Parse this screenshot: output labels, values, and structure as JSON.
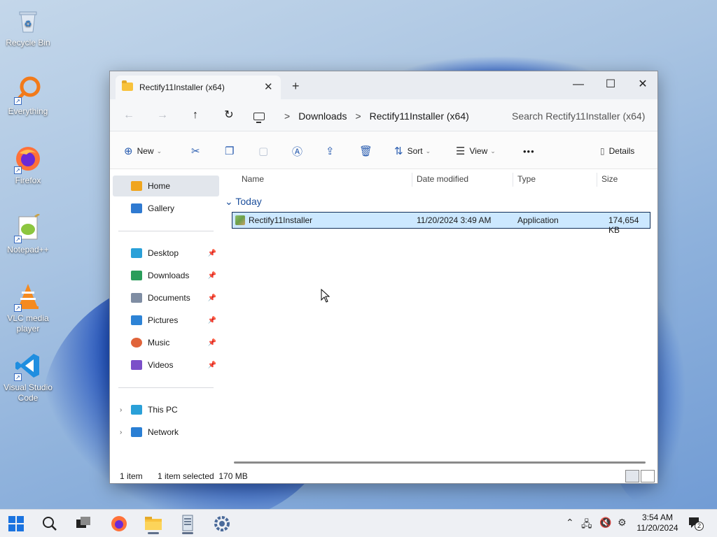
{
  "desktop": {
    "icons": [
      {
        "label": "Recycle Bin",
        "icon": "recycle-bin-icon"
      },
      {
        "label": "Everything",
        "icon": "everything-search-icon"
      },
      {
        "label": "Firefox",
        "icon": "firefox-icon"
      },
      {
        "label": "Notepad++",
        "icon": "notepad-plus-plus-icon"
      },
      {
        "label": "VLC media player",
        "icon": "vlc-icon"
      },
      {
        "label": "Visual Studio Code",
        "icon": "vscode-icon"
      }
    ]
  },
  "window": {
    "tab_title": "Rectify11Installer (x64)",
    "tab_close": "✕",
    "new_tab": "+",
    "controls": {
      "minimize": "—",
      "maximize": "☐",
      "close": "✕"
    },
    "nav": {
      "back": "←",
      "forward": "→",
      "up": "↑",
      "refresh": "↻"
    },
    "breadcrumb": [
      "Downloads",
      "Rectify11Installer (x64)"
    ],
    "breadcrumb_sep": ">",
    "search_placeholder": "Search Rectify11Installer (x64)",
    "toolbar": {
      "new_label": "New",
      "sort_label": "Sort",
      "view_label": "View",
      "more_label": "•••",
      "details_label": "Details"
    },
    "sidebar": {
      "top": [
        {
          "label": "Home",
          "icon": "home-icon",
          "color": "#f0a51e"
        },
        {
          "label": "Gallery",
          "icon": "gallery-icon",
          "color": "#2f7ad1"
        }
      ],
      "quick": [
        {
          "label": "Desktop",
          "icon": "desktop-icon",
          "color": "#2aa0d8"
        },
        {
          "label": "Downloads",
          "icon": "downloads-icon",
          "color": "#2a9d5a"
        },
        {
          "label": "Documents",
          "icon": "documents-icon",
          "color": "#7f8da3"
        },
        {
          "label": "Pictures",
          "icon": "pictures-icon",
          "color": "#2d83d6"
        },
        {
          "label": "Music",
          "icon": "music-icon",
          "color": "#e0643a"
        },
        {
          "label": "Videos",
          "icon": "videos-icon",
          "color": "#7b4fc9"
        }
      ],
      "bottom": [
        {
          "label": "This PC",
          "icon": "this-pc-icon",
          "color": "#2aa0d8"
        },
        {
          "label": "Network",
          "icon": "network-icon",
          "color": "#2a7fd4"
        }
      ],
      "pin_glyph": "📌"
    },
    "columns": [
      "Name",
      "Date modified",
      "Type",
      "Size"
    ],
    "group_label": "Today",
    "files": [
      {
        "name": "Rectify11Installer",
        "date": "11/20/2024 3:49 AM",
        "type": "Application",
        "size": "174,654 KB"
      }
    ],
    "status": {
      "count": "1 item",
      "selection": "1 item selected  170 MB"
    }
  },
  "taskbar": {
    "apps": [
      "start",
      "search",
      "task-view",
      "firefox",
      "file-explorer",
      "installer",
      "settings"
    ],
    "time": "3:54 AM",
    "date": "11/20/2024",
    "notification_count": "2"
  },
  "colors": {
    "accent": "#0078d4",
    "selection": "#cce8ff",
    "taskbar": "#eef0f4"
  }
}
